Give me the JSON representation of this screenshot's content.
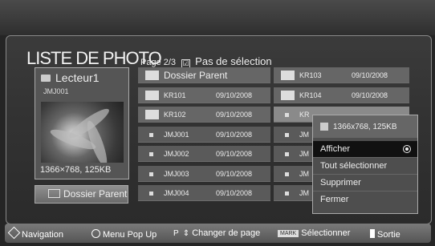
{
  "header": {
    "title": "LISTE DE PHOTO",
    "page_info": "Page 2/3",
    "select_label": "Pas de sélection"
  },
  "preview": {
    "device": "Lecteur1",
    "file_name": "JMJ001",
    "resolution": "1366×768, 125KB"
  },
  "parent_button": "Dossier Parent",
  "grid": {
    "col1": [
      {
        "name": "Dossier Parent",
        "date": "",
        "type": "parent"
      },
      {
        "name": "KR101",
        "date": "09/10/2008",
        "type": "folder"
      },
      {
        "name": "KR102",
        "date": "09/10/2008",
        "type": "folder"
      },
      {
        "name": "JMJ001",
        "date": "09/10/2008",
        "type": "photo"
      },
      {
        "name": "JMJ002",
        "date": "09/10/2008",
        "type": "photo"
      },
      {
        "name": "JMJ003",
        "date": "09/10/2008",
        "type": "photo"
      },
      {
        "name": "JMJ004",
        "date": "09/10/2008",
        "type": "photo"
      }
    ],
    "col2": [
      {
        "name": "KR103",
        "date": "09/10/2008",
        "type": "folder"
      },
      {
        "name": "KR104",
        "date": "09/10/2008",
        "type": "folder"
      },
      {
        "name": "KR",
        "date": "",
        "type": "photo"
      },
      {
        "name": "JM",
        "date": "",
        "type": "photo"
      },
      {
        "name": "JM",
        "date": "",
        "type": "photo"
      },
      {
        "name": "JM",
        "date": "",
        "type": "photo"
      },
      {
        "name": "JM",
        "date": "",
        "type": "photo"
      }
    ]
  },
  "popup": {
    "header": "1366x768, 125KB",
    "items": [
      "Afficher",
      "Tout sélectionner",
      "Supprimer",
      "Fermer"
    ],
    "active_index": 0
  },
  "bottom": {
    "navigation": "Navigation",
    "menu": "Menu Pop Up",
    "page_prefix": "P",
    "page": "Changer de page",
    "mark_key": "MARK",
    "select": "Sélectionner",
    "exit": "Sortie"
  }
}
